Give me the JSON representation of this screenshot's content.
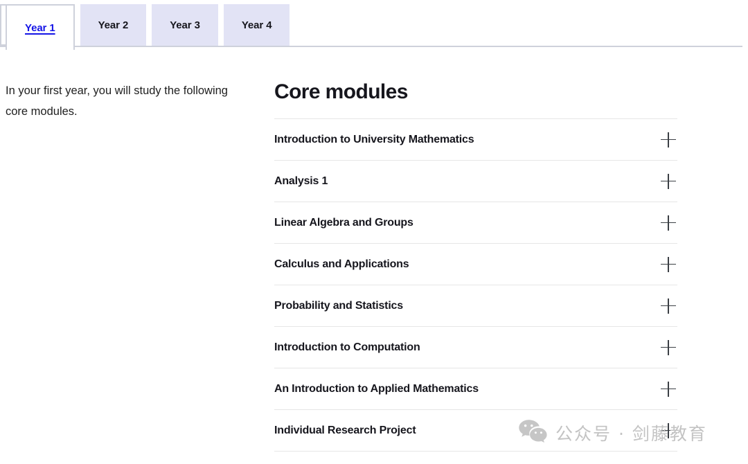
{
  "tabs": {
    "items": [
      {
        "label": "Year 1",
        "active": true
      },
      {
        "label": "Year 2",
        "active": false
      },
      {
        "label": "Year 3",
        "active": false
      },
      {
        "label": "Year 4",
        "active": false
      }
    ],
    "active_link_color": "#1414e6",
    "inactive_background": "#e2e3f5",
    "border_color": "#ced1db"
  },
  "intro": {
    "text": "In your first year, you will study the following core modules."
  },
  "main": {
    "heading": "Core modules",
    "modules": [
      {
        "title": "Introduction to University Mathematics",
        "toggle_icon": "plus-icon",
        "expanded": false
      },
      {
        "title": "Analysis 1",
        "toggle_icon": "plus-icon",
        "expanded": false
      },
      {
        "title": "Linear Algebra and Groups",
        "toggle_icon": "plus-icon",
        "expanded": false
      },
      {
        "title": "Calculus and Applications",
        "toggle_icon": "plus-icon",
        "expanded": false
      },
      {
        "title": "Probability and Statistics",
        "toggle_icon": "plus-icon",
        "expanded": false
      },
      {
        "title": "Introduction to Computation",
        "toggle_icon": "plus-icon",
        "expanded": false
      },
      {
        "title": "An Introduction to Applied Mathematics",
        "toggle_icon": "plus-icon",
        "expanded": false
      },
      {
        "title": "Individual Research Project",
        "toggle_icon": "plus-icon",
        "expanded": false
      }
    ],
    "divider_color": "#e6e6e6"
  },
  "watermark": {
    "text": "公众号 · 剑藤教育",
    "icon": "wechat-icon",
    "color": "#c3c3c3"
  }
}
